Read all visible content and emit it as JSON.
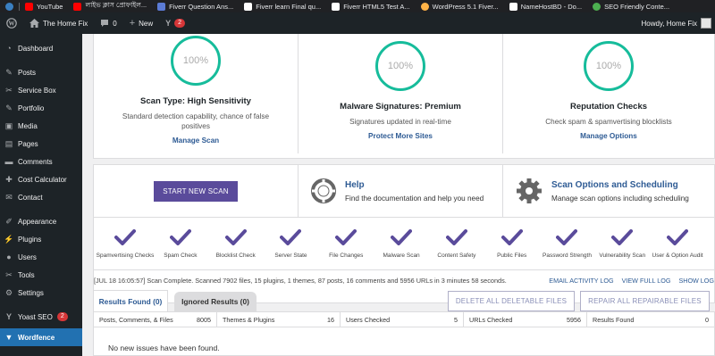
{
  "bookmarks": [
    {
      "label": "",
      "icon": "wordpress-icon",
      "color": "#3a7fc1"
    },
    {
      "label": "YouTube",
      "icon": "youtube-icon",
      "color": "#ff0000"
    },
    {
      "label": "লাইভ ক্লাস প্রোফাইল...",
      "icon": "youtube-icon",
      "color": "#ff0000"
    },
    {
      "label": "Fiverr Question Ans...",
      "icon": "fiverr-icon",
      "color": "#5b7bd5"
    },
    {
      "label": "Fiverr learn Final qu...",
      "icon": "document-icon",
      "color": "#ffffff"
    },
    {
      "label": "Fiverr HTML5 Test A...",
      "icon": "document-icon",
      "color": "#ffffff"
    },
    {
      "label": "WordPress 5.1 Fiver...",
      "icon": "wordpress-color-icon",
      "color": "#ffb347"
    },
    {
      "label": "NameHostBD - Do...",
      "icon": "document-icon",
      "color": "#ffffff"
    },
    {
      "label": "SEO Friendly Conte...",
      "icon": "chrome-icon",
      "color": "#4caf50"
    }
  ],
  "adminbar": {
    "site_name": "The Home Fix",
    "comments_count": "0",
    "new_label": "New",
    "yoast_badge": "2",
    "howdy": "Howdy, Home Fix"
  },
  "sidebar": {
    "items": [
      {
        "label": "Dashboard",
        "icon": "dashboard-icon"
      },
      {
        "label": "Posts",
        "icon": "pin-icon"
      },
      {
        "label": "Service Box",
        "icon": "wrench-icon"
      },
      {
        "label": "Portfolio",
        "icon": "pin-icon"
      },
      {
        "label": "Media",
        "icon": "media-icon"
      },
      {
        "label": "Pages",
        "icon": "pages-icon"
      },
      {
        "label": "Comments",
        "icon": "comment-icon"
      },
      {
        "label": "Cost Calculator",
        "icon": "calculator-icon"
      },
      {
        "label": "Contact",
        "icon": "mail-icon"
      },
      {
        "label": "Appearance",
        "icon": "brush-icon"
      },
      {
        "label": "Plugins",
        "icon": "plugin-icon"
      },
      {
        "label": "Users",
        "icon": "user-icon"
      },
      {
        "label": "Tools",
        "icon": "wrench-icon"
      },
      {
        "label": "Settings",
        "icon": "settings-icon"
      },
      {
        "label": "Yoast SEO",
        "icon": "yoast-icon",
        "badge": "2"
      },
      {
        "label": "Wordfence",
        "icon": "wordfence-icon",
        "active": true
      }
    ]
  },
  "stats": [
    {
      "percent": "100%",
      "title": "Scan Type: High Sensitivity",
      "desc": "Standard detection capability, chance of false positives",
      "link": "Manage Scan"
    },
    {
      "percent": "100%",
      "title": "Malware Signatures: Premium",
      "desc": "Signatures updated in real-time",
      "link": "Protect More Sites"
    },
    {
      "percent": "100%",
      "title": "Reputation Checks",
      "desc": "Check spam & spamvertising blocklists",
      "link": "Manage Options"
    }
  ],
  "actions": {
    "start_scan": "START NEW SCAN",
    "help_title": "Help",
    "help_desc": "Find the documentation and help you need",
    "options_title": "Scan Options and Scheduling",
    "options_desc": "Manage scan options including scheduling"
  },
  "checks": [
    "Spamvertising Checks",
    "Spam Check",
    "Blocklist Check",
    "Server State",
    "File Changes",
    "Malware Scan",
    "Content Safety",
    "Public Files",
    "Password Strength",
    "Vulnerability Scan",
    "User & Option Audit"
  ],
  "log": {
    "text": "[JUL 18 16:05:57] Scan Complete. Scanned 7902 files, 15 plugins, 1 themes, 87 posts, 16 comments and 5956 URLs in 3 minutes 58 seconds.",
    "email_link": "EMAIL ACTIVITY LOG",
    "full_link": "VIEW FULL LOG",
    "show_link": "SHOW LOG"
  },
  "results": {
    "tab_found": "Results Found (0)",
    "tab_ignored": "Ignored Results (0)",
    "delete_btn": "DELETE ALL DELETABLE FILES",
    "repair_btn": "REPAIR ALL REPAIRABLE FILES",
    "summary": [
      {
        "label": "Posts, Comments, & Files",
        "value": "8005"
      },
      {
        "label": "Themes & Plugins",
        "value": "16"
      },
      {
        "label": "Users Checked",
        "value": "5"
      },
      {
        "label": "URLs Checked",
        "value": "5956"
      },
      {
        "label": "Results Found",
        "value": "0"
      }
    ],
    "empty_text": "No new issues have been found."
  },
  "colors": {
    "accent_teal": "#16bc9b",
    "accent_purple": "#5a4b9b",
    "link_blue": "#2e5b94",
    "admin_dark": "#1d2327",
    "active_blue": "#2271b1"
  }
}
